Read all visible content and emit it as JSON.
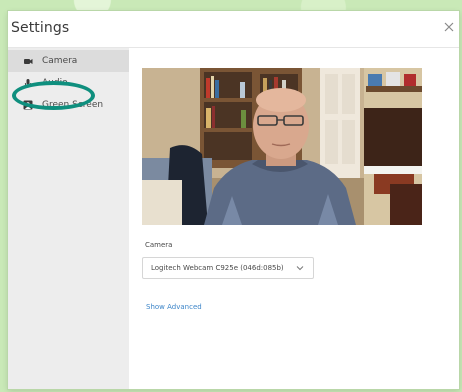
{
  "dialog": {
    "title": "Settings",
    "close_icon": "close-icon"
  },
  "sidebar": {
    "items": [
      {
        "label": "Camera",
        "icon": "camera-icon",
        "active": true
      },
      {
        "label": "Audio",
        "icon": "microphone-icon",
        "active": false
      },
      {
        "label": "Green Screen",
        "icon": "green-screen-icon",
        "active": false
      }
    ],
    "highlight_color": "#0f8f7e"
  },
  "camera_panel": {
    "preview_icon": "webcam-preview-image",
    "field_label": "Camera",
    "selected_camera": "Logitech Webcam C925e (046d:085b)",
    "dropdown_icon": "chevron-down-icon",
    "show_advanced_label": "Show Advanced"
  },
  "colors": {
    "sidebar_bg": "#ededed",
    "active_item_bg": "#dcdcdc",
    "link": "#3e86c9",
    "backdrop": "#c9e9b7"
  }
}
